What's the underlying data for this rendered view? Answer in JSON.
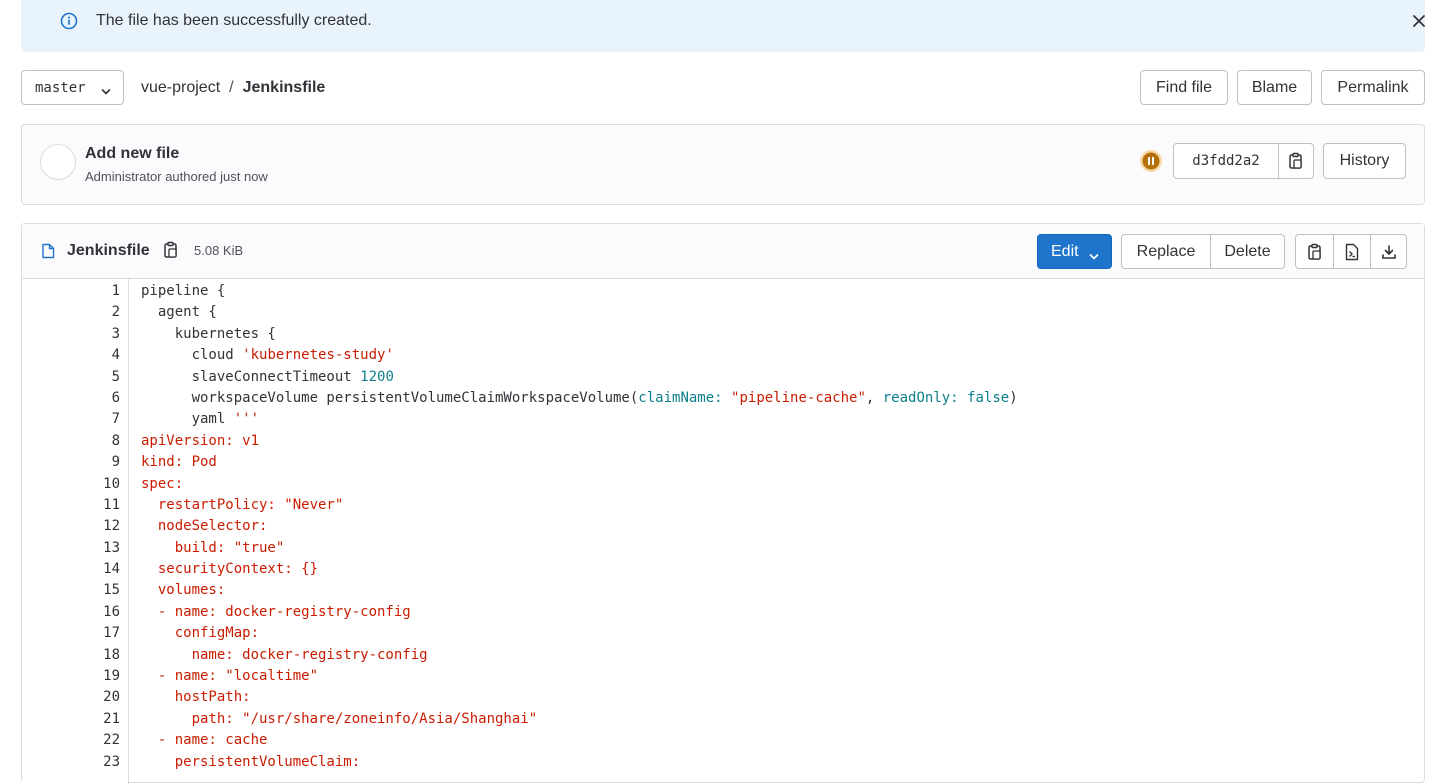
{
  "alert": {
    "message": "The file has been successfully created."
  },
  "nav": {
    "ref": "master",
    "breadcrumb": [
      "vue-project",
      "/",
      "Jenkinsfile"
    ],
    "find_file": "Find file",
    "blame": "Blame",
    "permalink": "Permalink"
  },
  "commit": {
    "title": "Add new file",
    "meta": "Administrator authored just now",
    "sha": "d3fdd2a2",
    "history": "History",
    "pipeline_status_color": "#b5700b"
  },
  "file": {
    "name": "Jenkinsfile",
    "size": "5.08 KiB",
    "edit": "Edit",
    "replace": "Replace",
    "delete": "Delete"
  },
  "code": [
    {
      "n": "1",
      "parts": [
        [
          "p",
          "pipeline {"
        ]
      ]
    },
    {
      "n": "2",
      "parts": [
        [
          "p",
          "  agent {"
        ]
      ]
    },
    {
      "n": "3",
      "parts": [
        [
          "p",
          "    kubernetes {"
        ]
      ]
    },
    {
      "n": "4",
      "parts": [
        [
          "p",
          "      cloud "
        ],
        [
          "s",
          "'kubernetes-study'"
        ]
      ]
    },
    {
      "n": "5",
      "parts": [
        [
          "p",
          "      slaveConnectTimeout "
        ],
        [
          "n",
          "1200"
        ]
      ]
    },
    {
      "n": "6",
      "parts": [
        [
          "p",
          "      workspaceVolume persistentVolumeClaimWorkspaceVolume("
        ],
        [
          "a",
          "claimName:"
        ],
        [
          "p",
          " "
        ],
        [
          "s",
          "\"pipeline-cache\""
        ],
        [
          "p",
          ", "
        ],
        [
          "a",
          "readOnly:"
        ],
        [
          "p",
          " "
        ],
        [
          "a",
          "false"
        ],
        [
          "p",
          ")"
        ]
      ]
    },
    {
      "n": "7",
      "parts": [
        [
          "p",
          "      yaml "
        ],
        [
          "s",
          "'''"
        ]
      ]
    },
    {
      "n": "8",
      "parts": [
        [
          "y",
          "apiVersion: v1"
        ]
      ]
    },
    {
      "n": "9",
      "parts": [
        [
          "y",
          "kind: Pod"
        ]
      ]
    },
    {
      "n": "10",
      "parts": [
        [
          "y",
          "spec:"
        ]
      ]
    },
    {
      "n": "11",
      "parts": [
        [
          "y",
          "  restartPolicy: \"Never\""
        ]
      ]
    },
    {
      "n": "12",
      "parts": [
        [
          "y",
          "  nodeSelector:"
        ]
      ]
    },
    {
      "n": "13",
      "parts": [
        [
          "y",
          "    build: \"true\""
        ]
      ]
    },
    {
      "n": "14",
      "parts": [
        [
          "y",
          "  securityContext: {}"
        ]
      ]
    },
    {
      "n": "15",
      "parts": [
        [
          "y",
          "  volumes:"
        ]
      ]
    },
    {
      "n": "16",
      "parts": [
        [
          "y",
          "  - name: docker-registry-config"
        ]
      ]
    },
    {
      "n": "17",
      "parts": [
        [
          "y",
          "    configMap:"
        ]
      ]
    },
    {
      "n": "18",
      "parts": [
        [
          "y",
          "      name: docker-registry-config"
        ]
      ]
    },
    {
      "n": "19",
      "parts": [
        [
          "y",
          "  - name: \"localtime\""
        ]
      ]
    },
    {
      "n": "20",
      "parts": [
        [
          "y",
          "    hostPath:"
        ]
      ]
    },
    {
      "n": "21",
      "parts": [
        [
          "y",
          "      path: \"/usr/share/zoneinfo/Asia/Shanghai\""
        ]
      ]
    },
    {
      "n": "22",
      "parts": [
        [
          "y",
          "  - name: cache"
        ]
      ]
    },
    {
      "n": "23",
      "parts": [
        [
          "y",
          "    persistentVolumeClaim:"
        ]
      ]
    }
  ]
}
